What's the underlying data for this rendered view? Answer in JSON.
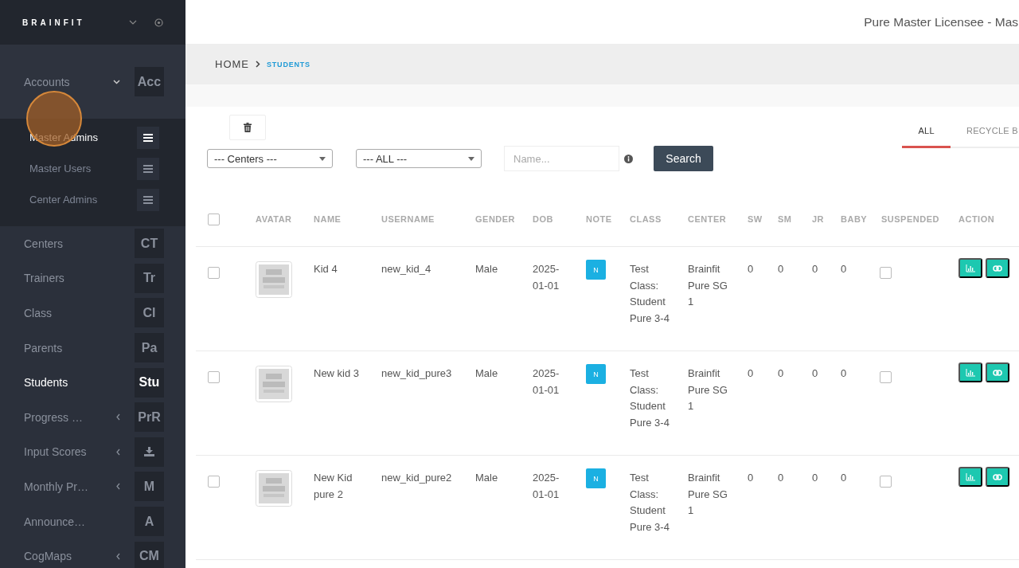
{
  "sidebar": {
    "logo": "BRAINFIT",
    "items": [
      {
        "label": "Accounts",
        "kind": "text",
        "badge": "Acc",
        "expandable": true,
        "selected": false,
        "expanded": true,
        "children": [
          {
            "label": "Master Admins",
            "selected": true
          },
          {
            "label": "Master Users",
            "selected": false
          },
          {
            "label": "Center Admins",
            "selected": false
          }
        ]
      },
      {
        "label": "Centers",
        "kind": "text",
        "badge": "CT",
        "expandable": false,
        "selected": false,
        "expanded": false
      },
      {
        "label": "Trainers",
        "kind": "text",
        "badge": "Tr",
        "expandable": false,
        "selected": false,
        "expanded": false
      },
      {
        "label": "Class",
        "kind": "text",
        "badge": "Cl",
        "expandable": false,
        "selected": false,
        "expanded": false
      },
      {
        "label": "Parents",
        "kind": "text",
        "badge": "Pa",
        "expandable": false,
        "selected": false,
        "expanded": false
      },
      {
        "label": "Students",
        "kind": "text",
        "badge": "Stu",
        "expandable": false,
        "selected": true,
        "expanded": false
      },
      {
        "label": "Progress …",
        "kind": "text",
        "badge": "PrR",
        "expandable": true,
        "selected": false,
        "expanded": false
      },
      {
        "label": "Input Scores",
        "kind": "icon",
        "expandable": true,
        "selected": false,
        "expanded": false
      },
      {
        "label": "Monthly Pr…",
        "kind": "text",
        "badge": "M",
        "expandable": true,
        "selected": false,
        "expanded": false
      },
      {
        "label": "Announce…",
        "kind": "text",
        "badge": "A",
        "expandable": false,
        "selected": false,
        "expanded": false
      },
      {
        "label": "CogMaps",
        "kind": "text",
        "badge": "CM",
        "expandable": true,
        "selected": false,
        "expanded": false
      }
    ]
  },
  "header": {
    "user": "Pure Master Licensee - Mas"
  },
  "breadcrumb": [
    {
      "label": "HOME",
      "selected": false
    },
    {
      "label": "STUDENTS",
      "selected": true
    }
  ],
  "filters": {
    "centers": "--- Centers ---",
    "type": "--- ALL ---",
    "search": {
      "placeholder": "Name..."
    },
    "search_button": "Search"
  },
  "tabs": [
    {
      "label": "ALL",
      "selected": true
    },
    {
      "label": "RECYCLE B",
      "selected": false
    }
  ],
  "table": {
    "all_checked": false,
    "columns": [
      "AVATAR",
      "NAME",
      "USERNAME",
      "GENDER",
      "DOB",
      "NOTE",
      "CLASS",
      "CENTER",
      "SW",
      "SM",
      "JR",
      "BABY",
      "SUSPENDED",
      "ACTION"
    ],
    "rows": [
      {
        "checked": false,
        "name": "Kid 4",
        "username": "new_kid_4",
        "gender": "Male",
        "dob": "2025-01-01",
        "note": "N",
        "class": "Test Class: Student Pure 3-4",
        "center": "Brainfit Pure SG 1",
        "sw": "0",
        "sm": "0",
        "jr": "0",
        "baby": "0",
        "suspended": false
      },
      {
        "checked": false,
        "name": "New kid 3",
        "username": "new_kid_pure3",
        "gender": "Male",
        "dob": "2025-01-01",
        "note": "N",
        "class": "Test Class: Student Pure 3-4",
        "center": "Brainfit Pure SG 1",
        "sw": "0",
        "sm": "0",
        "jr": "0",
        "baby": "0",
        "suspended": false
      },
      {
        "checked": false,
        "name": "New Kid pure 2",
        "username": "new_kid_pure2",
        "gender": "Male",
        "dob": "2025-01-01",
        "note": "N",
        "class": "Test Class: Student Pure 3-4",
        "center": "Brainfit Pure SG 1",
        "sw": "0",
        "sm": "0",
        "jr": "0",
        "baby": "0",
        "suspended": false
      }
    ]
  }
}
